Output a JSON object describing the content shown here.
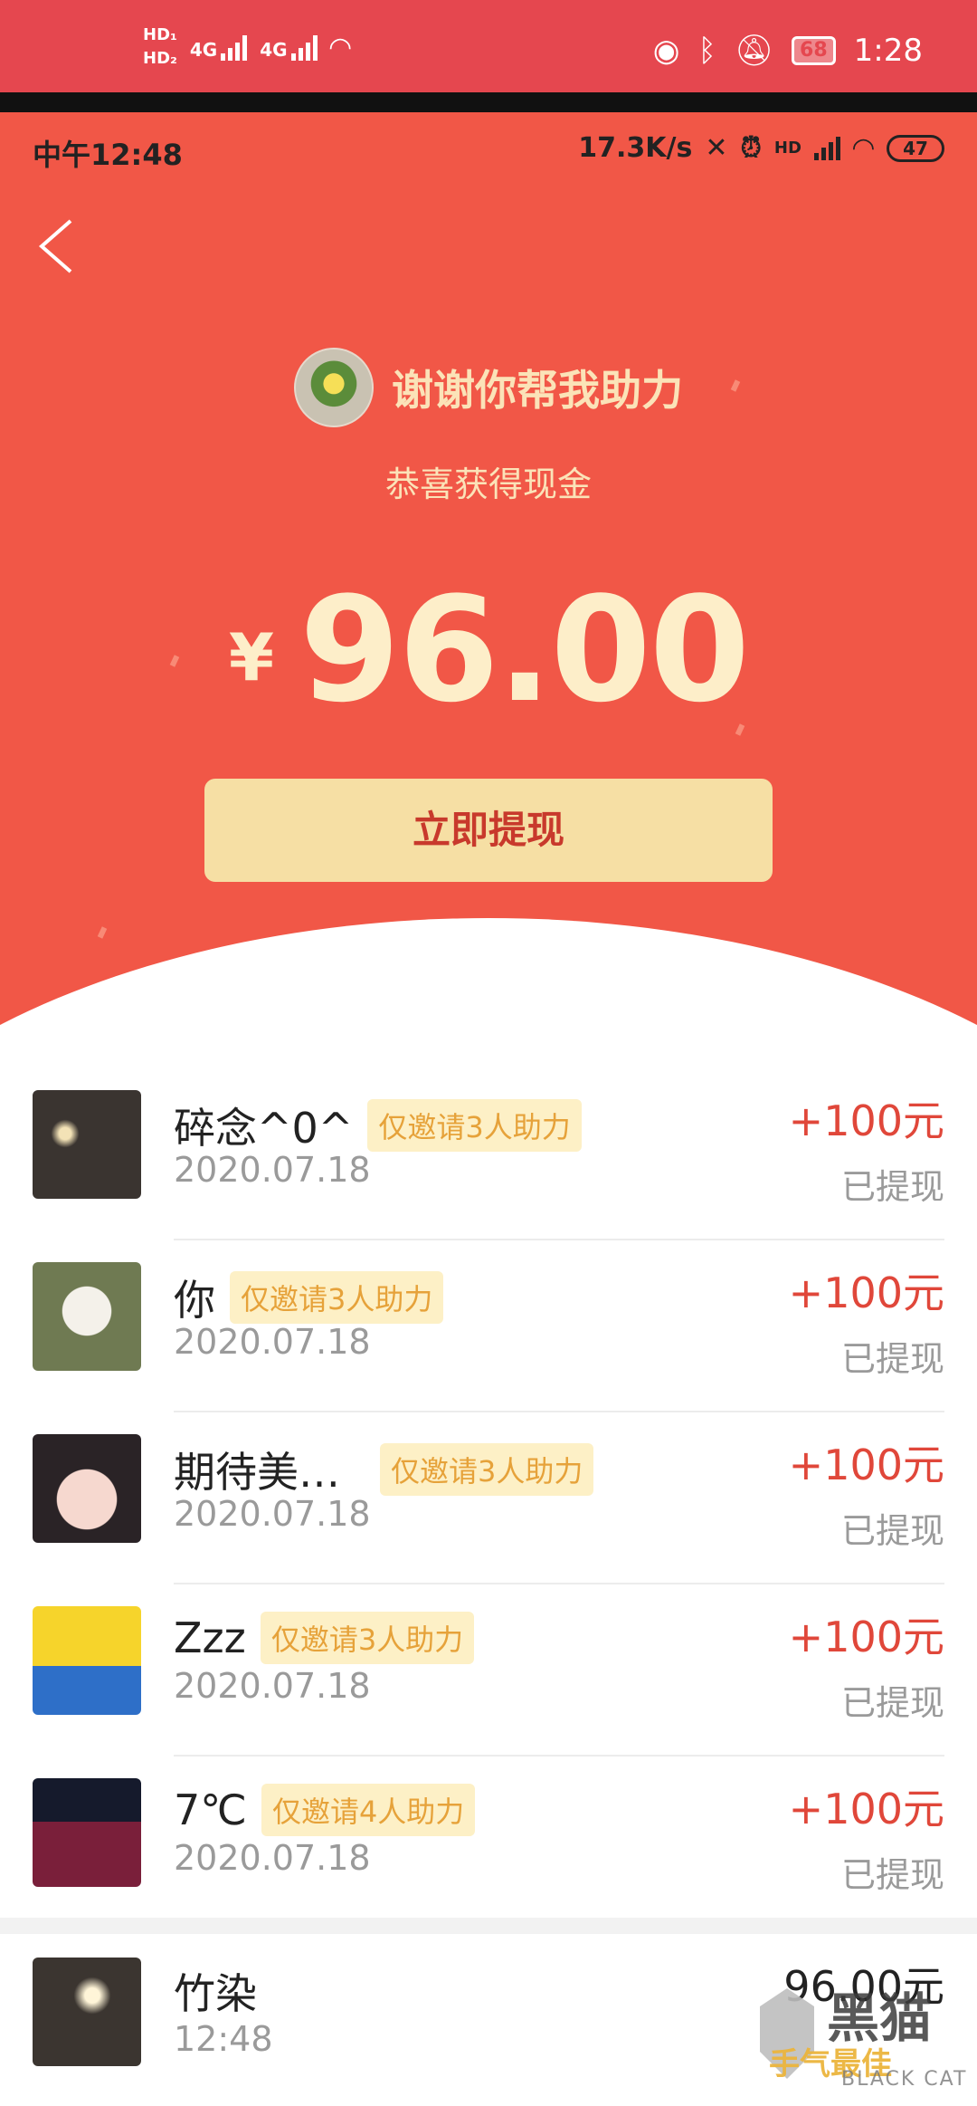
{
  "outer_status": {
    "hd1": "HD₁",
    "hd2": "HD₂",
    "net1": "4G",
    "net2": "4G",
    "battery": "68",
    "time": "1:28"
  },
  "inner_status": {
    "time": "中午12:48",
    "speed": "17.3K/s",
    "hd": "HD",
    "battery": "47"
  },
  "header": {
    "title": "谢谢你帮我助力",
    "subtitle": "恭喜获得现金",
    "currency": "¥",
    "amount": "96.00",
    "withdraw_label": "立即提现"
  },
  "records": [
    {
      "name": "碎念^0^",
      "tag": "仅邀请3人助力",
      "date": "2020.07.18",
      "amount": "+100元",
      "status": "已提现"
    },
    {
      "name": "你",
      "tag": "仅邀请3人助力",
      "date": "2020.07.18",
      "amount": "+100元",
      "status": "已提现"
    },
    {
      "name": "期待美…",
      "tag": "仅邀请3人助力",
      "date": "2020.07.18",
      "amount": "+100元",
      "status": "已提现"
    },
    {
      "name": "Zzz",
      "tag": "仅邀请3人助力",
      "date": "2020.07.18",
      "amount": "+100元",
      "status": "已提现"
    },
    {
      "name": "7℃",
      "tag": "仅邀请4人助力",
      "date": "2020.07.18",
      "amount": "+100元",
      "status": "已提现"
    }
  ],
  "last_record": {
    "name": "竹染",
    "time": "12:48",
    "amount": "96.00元"
  },
  "watermark": {
    "brand": "黑猫",
    "slogan": "手气最佳",
    "english": "BLACK CAT"
  },
  "colors": {
    "header_red": "#f15747",
    "button_yellow": "#f6dfa4",
    "amount_red": "#e0473a",
    "tag_text": "#e6a23a"
  }
}
